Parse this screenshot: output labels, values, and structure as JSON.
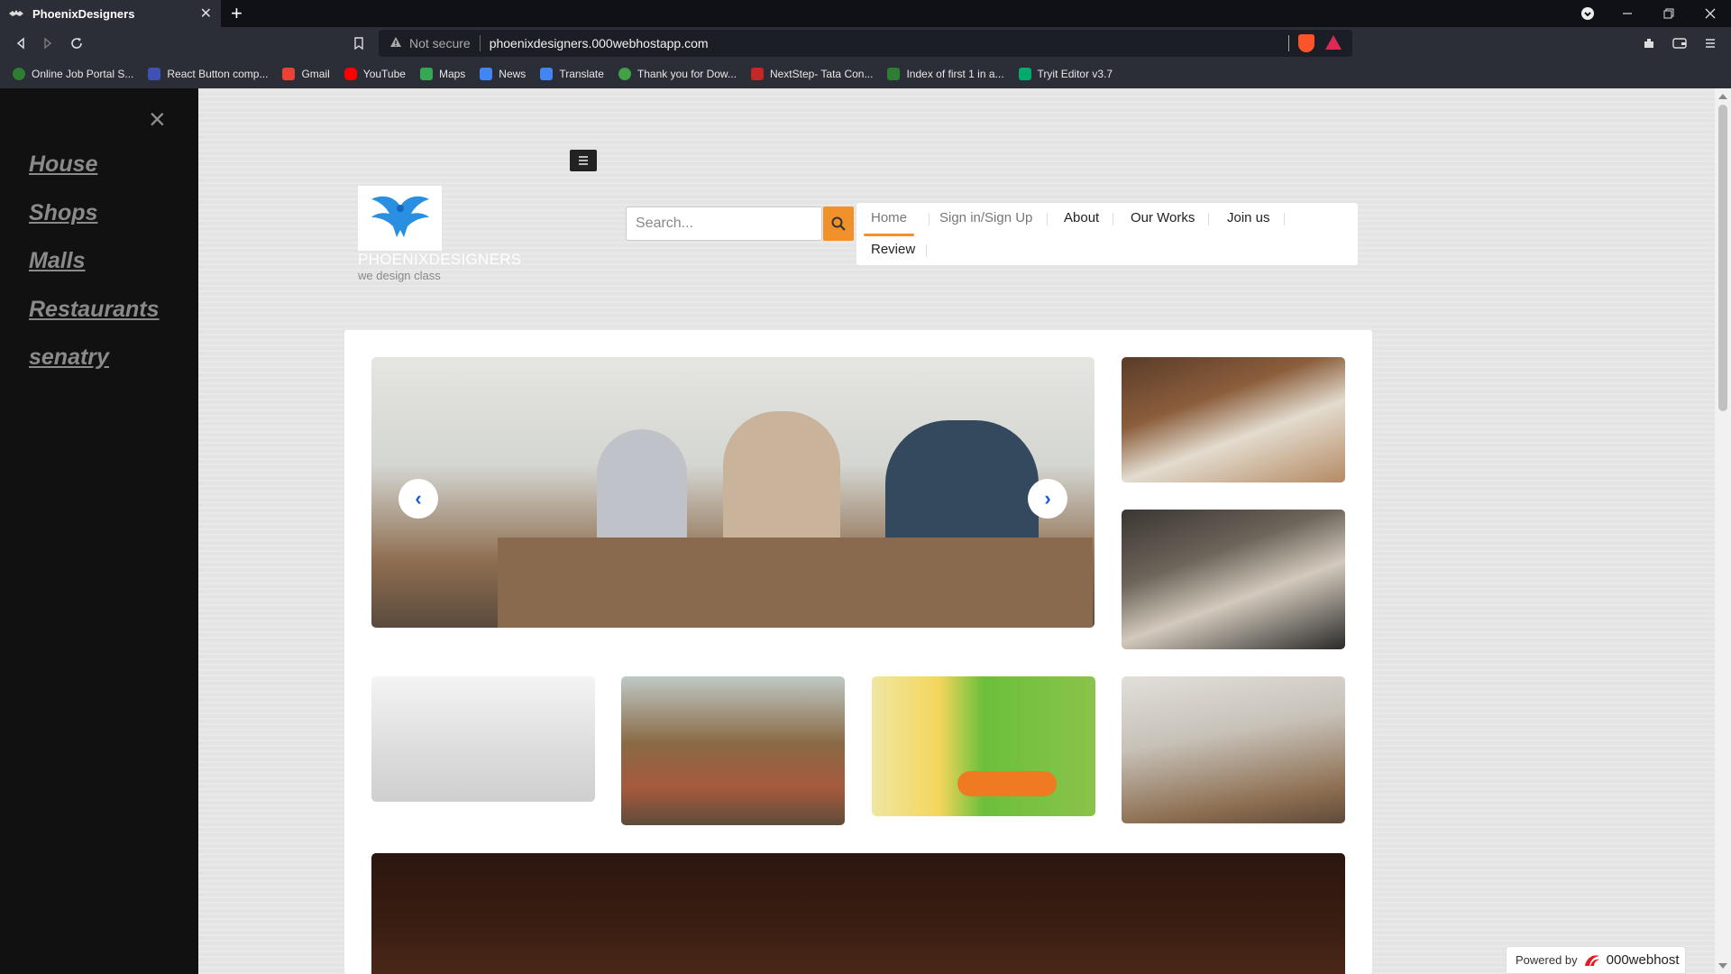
{
  "browser": {
    "tab_title": "PhoenixDesigners",
    "tab_close": "✕",
    "new_tab": "+",
    "security_label": "Not secure",
    "url": "phoenixdesigners.000webhostapp.com",
    "bookmarks": [
      {
        "label": "Online Job Portal S...",
        "color": "#2e7d32"
      },
      {
        "label": "React Button comp...",
        "color": "#3f51b5"
      },
      {
        "label": "Gmail",
        "color": "#ea4335"
      },
      {
        "label": "YouTube",
        "color": "#ff0000"
      },
      {
        "label": "Maps",
        "color": "#34a853"
      },
      {
        "label": "News",
        "color": "#4285f4"
      },
      {
        "label": "Translate",
        "color": "#4285f4"
      },
      {
        "label": "Thank you for Dow...",
        "color": "#43a047"
      },
      {
        "label": "NextStep- Tata Con...",
        "color": "#c62828"
      },
      {
        "label": "Index of first 1 in a...",
        "color": "#2e7d32"
      },
      {
        "label": "Tryit Editor v3.7",
        "color": "#04aa6d"
      }
    ]
  },
  "sidenav": {
    "close": "×",
    "items": [
      "House",
      "Shops",
      "Malls",
      "Restaurants",
      "senatry"
    ]
  },
  "header": {
    "brand": "PHOENIXDESIGNERS",
    "tagline": "we design class",
    "search_placeholder": "Search...",
    "menu": {
      "home": "Home",
      "signin": "Sign in/Sign Up",
      "about": "About",
      "works": "Our Works",
      "join": "Join us",
      "review": "Review"
    }
  },
  "slider": {
    "prev": "‹",
    "next": "›"
  },
  "footer_badge": {
    "powered_by": "Powered by",
    "host": "000webhost"
  },
  "colors": {
    "accent": "#f0912b",
    "sidenav_bg": "#111111",
    "arrow": "#1a5fd0"
  }
}
